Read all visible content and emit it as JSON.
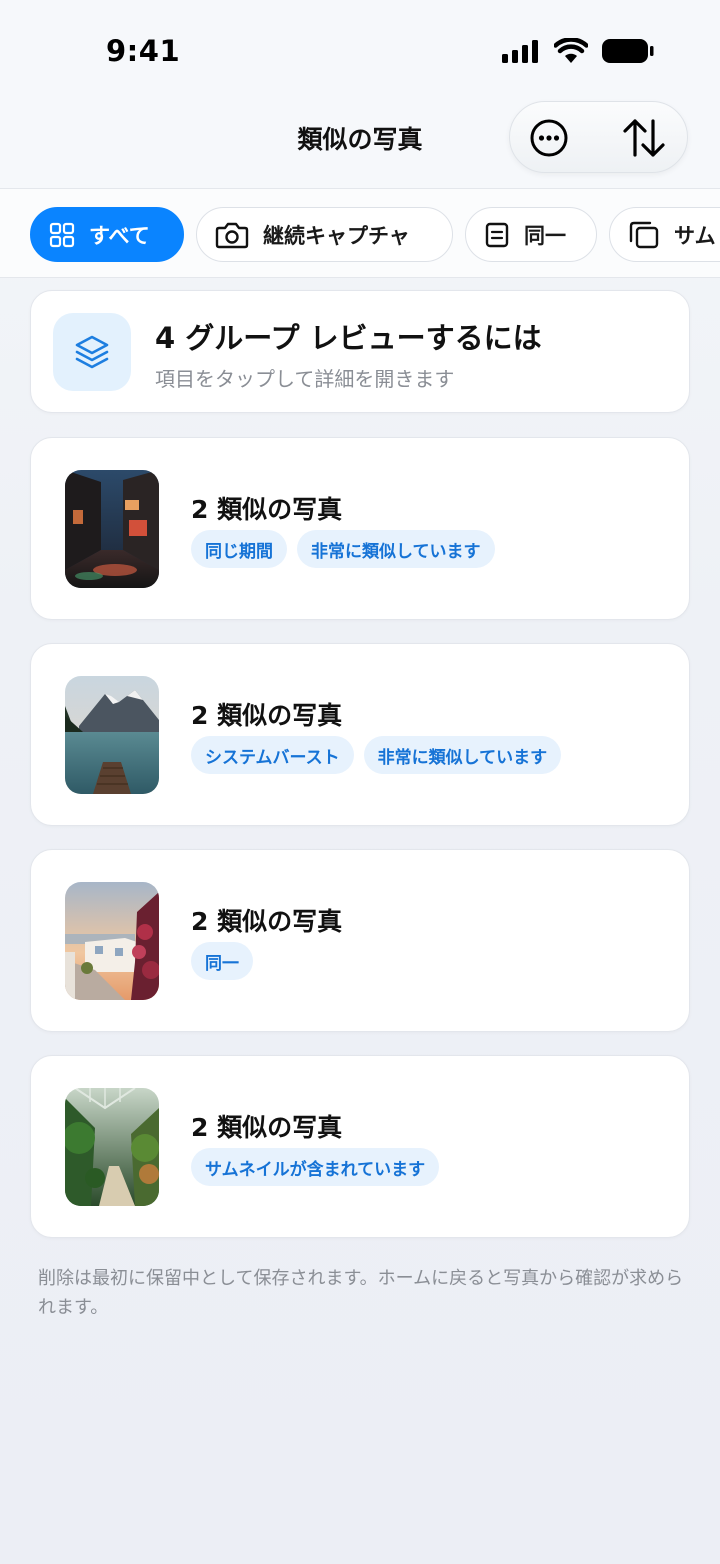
{
  "status_bar": {
    "time": "9:41"
  },
  "nav": {
    "title": "類似の写真"
  },
  "filters": [
    {
      "label": "すべて",
      "icon": "grid-icon",
      "active": true
    },
    {
      "label": "継続キャプチャ",
      "icon": "camera-icon",
      "active": false
    },
    {
      "label": "同一",
      "icon": "document-icon",
      "active": false
    },
    {
      "label": "サム",
      "icon": "copy-icon",
      "active": false
    }
  ],
  "hint": {
    "title": "4 グループ レビューするには",
    "subtitle": "項目をタップして詳細を開きます",
    "icon": "layers-icon"
  },
  "groups": [
    {
      "title": "2 類似の写真",
      "tags": [
        "同じ期間",
        "非常に類似しています"
      ],
      "thumbnail": "rainy-alley-night"
    },
    {
      "title": "2 類似の写真",
      "tags": [
        "システムバースト",
        "非常に類似しています"
      ],
      "thumbnail": "mountain-lake-dock"
    },
    {
      "title": "2 類似の写真",
      "tags": [
        "同一"
      ],
      "thumbnail": "seaside-village-sunset"
    },
    {
      "title": "2 類似の写真",
      "tags": [
        "サムネイルが含まれています"
      ],
      "thumbnail": "greenhouse-garden-path"
    }
  ],
  "footer_note": "削除は最初に保留中として保存されます。ホームに戻ると写真から確認が求められます。",
  "colors": {
    "accent": "#0a84ff",
    "tag_bg": "#e7f2fd",
    "tag_text": "#1673d6"
  }
}
